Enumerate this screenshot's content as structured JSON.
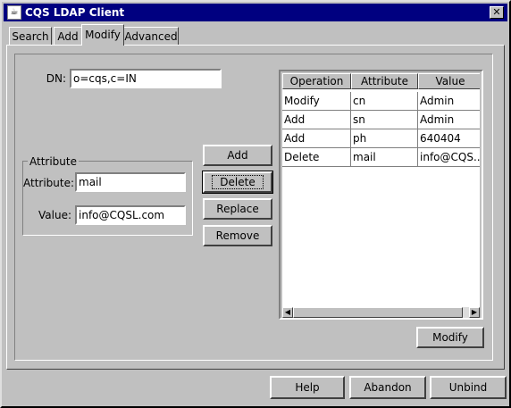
{
  "window": {
    "title": "CQS LDAP Client"
  },
  "tabs": [
    {
      "label": "Search"
    },
    {
      "label": "Add"
    },
    {
      "label": "Modify"
    },
    {
      "label": "Advanced"
    }
  ],
  "form": {
    "dn_label": "DN:",
    "dn_value": "o=cqs,c=IN",
    "group_title": "Attribute",
    "attribute_label": "Attribute:",
    "attribute_value": "mail",
    "value_label": "Value:",
    "value_value": "info@CQSL.com"
  },
  "actions": {
    "add": "Add",
    "delete": "Delete",
    "replace": "Replace",
    "remove": "Remove",
    "modify": "Modify"
  },
  "table": {
    "columns": [
      "Operation",
      "Attribute",
      "Value"
    ],
    "rows": [
      [
        "Modify",
        "cn",
        "Admin"
      ],
      [
        "Add",
        "sn",
        "Admin"
      ],
      [
        "Add",
        "ph",
        "640404"
      ],
      [
        "Delete",
        "mail",
        "info@CQS..."
      ]
    ]
  },
  "footer": {
    "help": "Help",
    "abandon": "Abandon",
    "unbind": "Unbind"
  },
  "icons": {
    "app": "ldap-app-icon",
    "close": "close-icon",
    "left": "arrow-left-icon",
    "right": "arrow-right-icon"
  }
}
